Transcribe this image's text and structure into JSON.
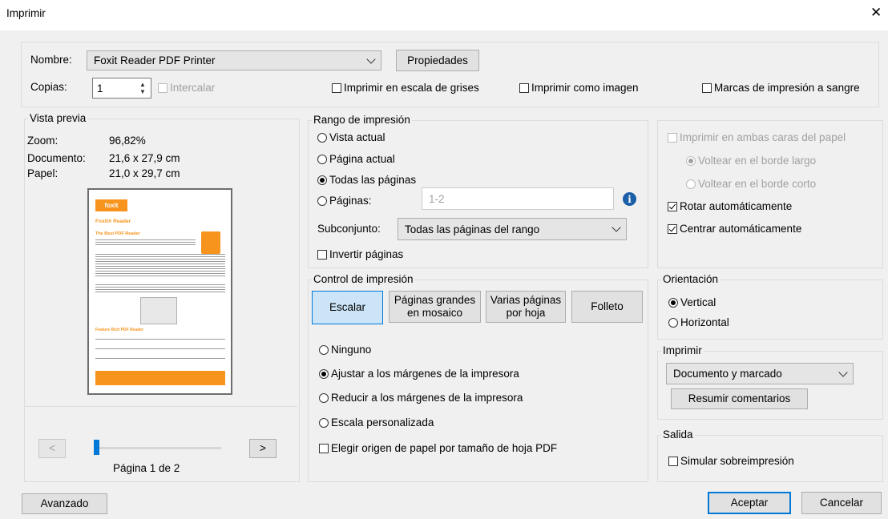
{
  "window": {
    "title": "Imprimir",
    "close_glyph": "✕"
  },
  "printer": {
    "name_label": "Nombre:",
    "name_value": "Foxit Reader PDF Printer",
    "properties_button": "Propiedades",
    "copies_label": "Copias:",
    "copies_value": "1",
    "collate_label": "Intercalar",
    "grayscale_label": "Imprimir en escala de grises",
    "as_image_label": "Imprimir como imagen",
    "bleed_marks_label": "Marcas de impresión a sangre"
  },
  "preview": {
    "legend": "Vista previa",
    "zoom_label": "Zoom:",
    "zoom_value": "96,82%",
    "document_label": "Documento:",
    "document_value": "21,6 x 27,9 cm",
    "paper_label": "Papel:",
    "paper_value": "21,0 x 29,7 cm",
    "thumb": {
      "logo": "foxit",
      "product": "Foxit® Reader",
      "headline": "The Best PDF Reader",
      "section": "Feature Rich PDF Reader",
      "accent_color": "#f7941d"
    },
    "prev_button": "<",
    "next_button": ">",
    "page_indicator": "Página 1 de 2"
  },
  "range": {
    "legend": "Rango de impresión",
    "current_view": "Vista actual",
    "current_page": "Página actual",
    "all_pages": "Todas las páginas",
    "pages": "Páginas:",
    "pages_value": "1-2",
    "info_icon_glyph": "i",
    "subset_label": "Subconjunto:",
    "subset_value": "Todas las páginas del rango",
    "reverse_pages": "Invertir páginas"
  },
  "options": {
    "duplex": "Imprimir en ambas caras del papel",
    "flip_long": "Voltear en el borde largo",
    "flip_short": "Voltear en el borde corto",
    "auto_rotate": "Rotar automáticamente",
    "auto_center": "Centrar automáticamente"
  },
  "control": {
    "legend": "Control de impresión",
    "scale_tab": "Escalar",
    "tile_tab": "Páginas grandes en mosaico",
    "multi_tab": "Varias páginas por hoja",
    "booklet_tab": "Folleto",
    "none": "Ninguno",
    "fit_margins": "Ajustar a los márgenes de la impresora",
    "reduce_margins": "Reducir a los márgenes de la impresora",
    "custom_scale": "Escala personalizada",
    "paper_source": "Elegir origen de papel por tamaño de hoja PDF"
  },
  "orientation": {
    "legend": "Orientación",
    "portrait": "Vertical",
    "landscape": "Horizontal"
  },
  "print_what": {
    "legend": "Imprimir",
    "value": "Documento y marcado",
    "summarize_button": "Resumir comentarios"
  },
  "output": {
    "legend": "Salida",
    "simulate_overprint": "Simular sobreimpresión"
  },
  "footer": {
    "advanced_button": "Avanzado",
    "ok_button": "Aceptar",
    "cancel_button": "Cancelar"
  },
  "colors": {
    "accent": "#0078d7",
    "info_icon": "#1b5fa8",
    "dialog_bg": "#f0f0f0"
  }
}
